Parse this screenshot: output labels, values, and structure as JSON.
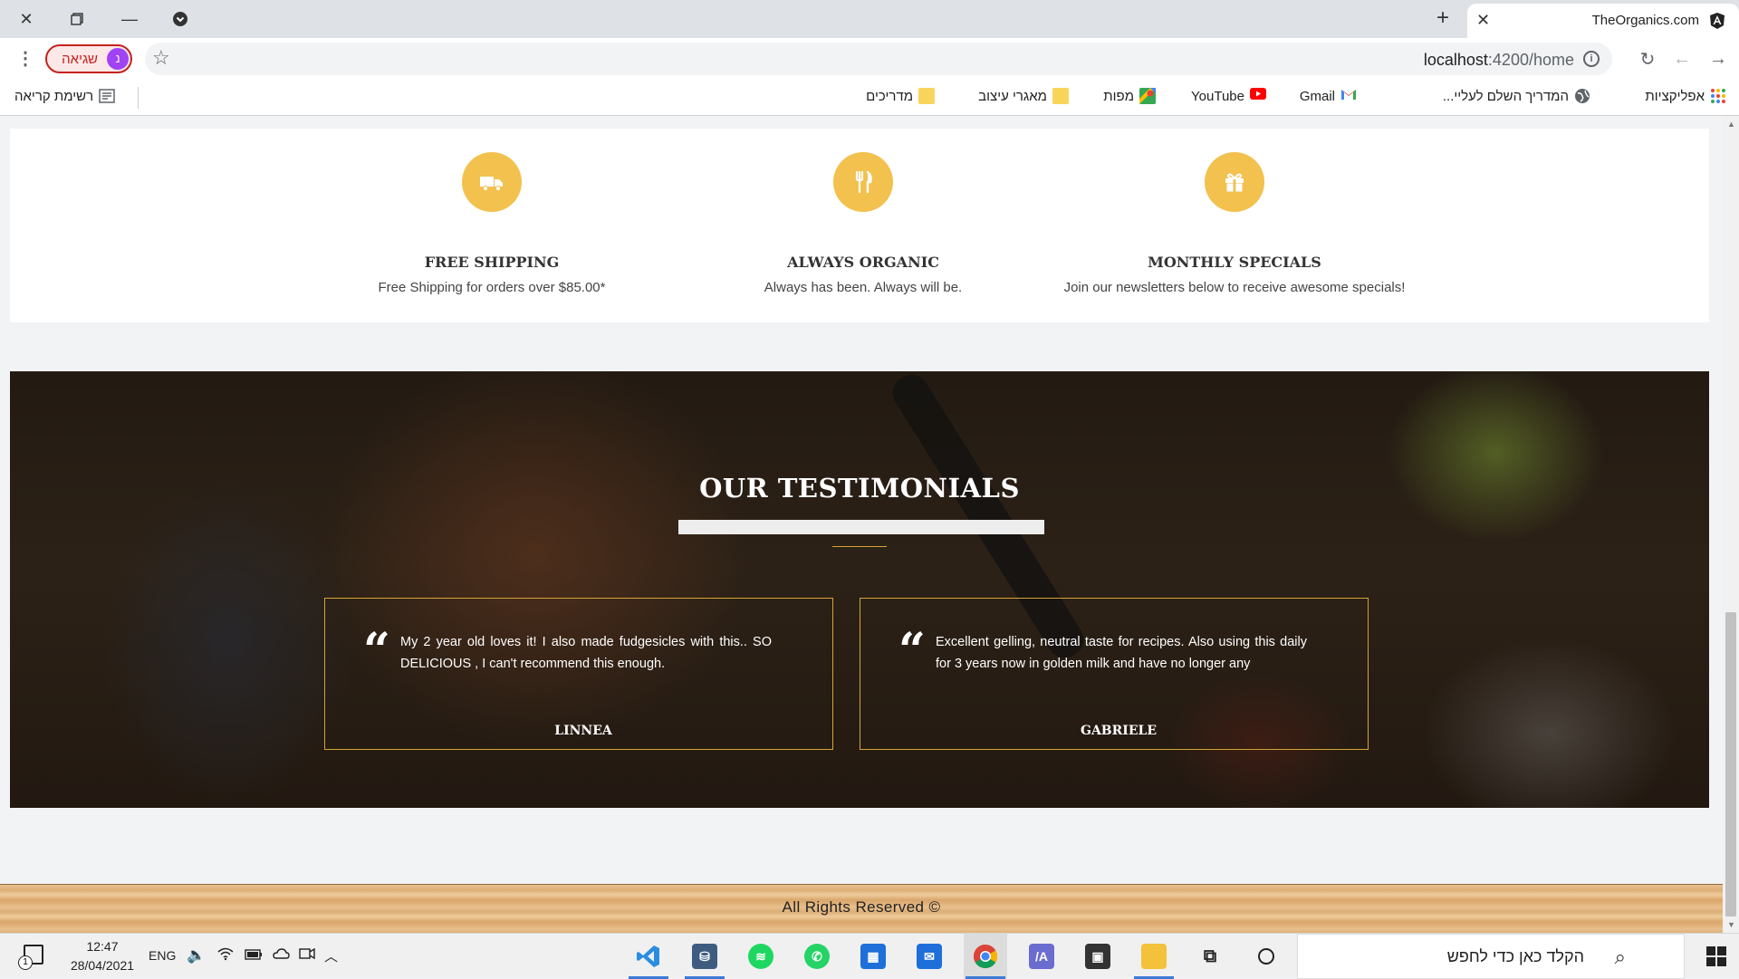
{
  "browser": {
    "tab_title": "TheOrganics.com",
    "url_host": "localhost",
    "url_path": ":4200/home",
    "profile_badge_letter": "נ",
    "profile_error_label": "שגיאה",
    "bookmarks": [
      {
        "label": "אפליקציות",
        "icon": "apps-grid-icon"
      },
      {
        "label": "המדריך השלם לעליי...",
        "icon": "globe-icon"
      },
      {
        "label": "Gmail",
        "icon": "gmail-icon"
      },
      {
        "label": "YouTube",
        "icon": "youtube-icon"
      },
      {
        "label": "מפות",
        "icon": "maps-icon"
      },
      {
        "label": "מאגרי עיצוב",
        "icon": "folder-icon"
      },
      {
        "label": "מדריכים",
        "icon": "folder-icon"
      }
    ],
    "reading_list_label": "רשימת קריאה"
  },
  "features": [
    {
      "title": "FREE SHIPPING",
      "description": "Free Shipping for orders over $85.00*",
      "icon": "truck-icon"
    },
    {
      "title": "ALWAYS ORGANIC",
      "description": "Always has been. Always will be.",
      "icon": "utensils-icon"
    },
    {
      "title": "MONTHLY SPECIALS",
      "description": "Join our newsletters below to receive awesome specials!",
      "icon": "gift-icon"
    }
  ],
  "testimonials": {
    "heading": "OUR TESTIMONIALS",
    "items": [
      {
        "text": "My 2 year old loves it! I also made fudgesicles with this.. SO DELICIOUS , I can't recommend this enough.",
        "author": "LINNEA"
      },
      {
        "text": "Excellent gelling, neutral taste for recipes. Also using this daily for 3 years now in golden milk and have no longer any",
        "author": "GABRIELE"
      }
    ]
  },
  "footer": {
    "text": "All Rights Reserved ©"
  },
  "taskbar": {
    "search_placeholder": "הקלד כאן כדי לחפש",
    "time": "12:47",
    "date": "28/04/2021",
    "language": "ENG",
    "notification_count": "1"
  },
  "colors": {
    "accent": "#f2c14e",
    "card_border": "#d4a437",
    "active_indicator": "#3d7bd9"
  }
}
